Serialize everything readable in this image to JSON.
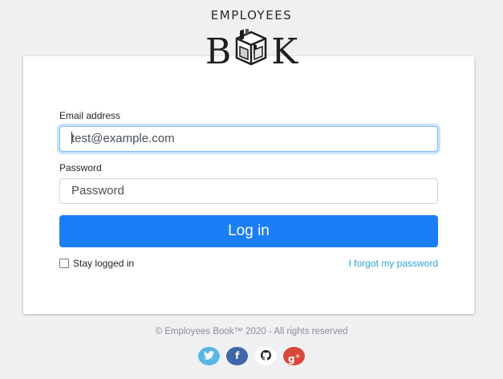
{
  "brand": {
    "top_text": "EMPLOYEES",
    "book_b": "B",
    "book_k": "K"
  },
  "form": {
    "email_label": "Email address",
    "email_placeholder": "test@example.com",
    "password_label": "Password",
    "password_placeholder": "Password",
    "login_label": "Log in",
    "stay_logged_in_label": "Stay logged in",
    "forgot_link": "I forgot my password"
  },
  "footer": {
    "copyright": "© Employees Book™ 2020 - All rights reserved"
  },
  "social": {
    "twitter_color": "#5bb6e8",
    "facebook_color": "#3f66a8",
    "github_color": "#ffffff",
    "googleplus_color": "#d9473a"
  },
  "colors": {
    "primary": "#1a7ef7",
    "link": "#2ba3db"
  }
}
